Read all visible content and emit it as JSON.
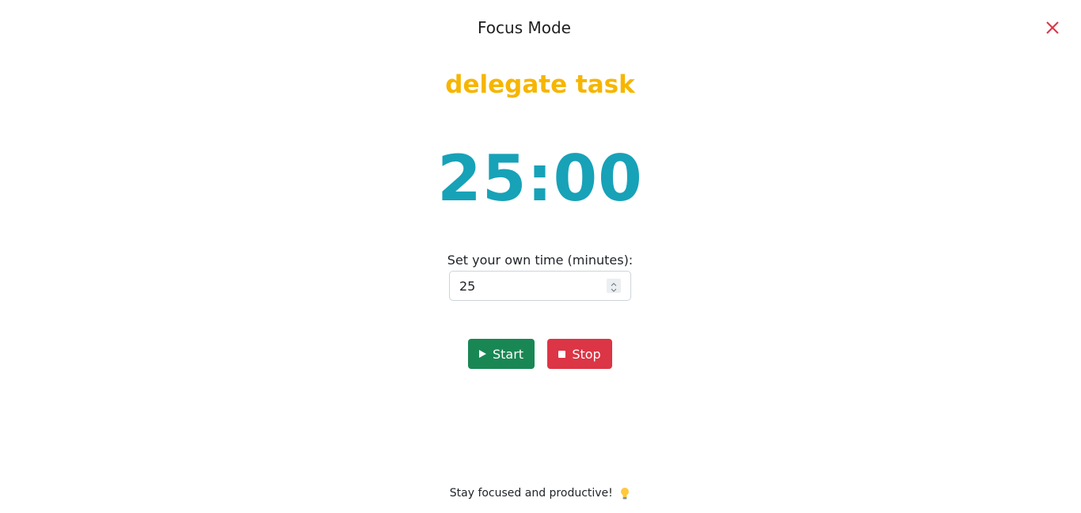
{
  "header": {
    "title": "Focus Mode"
  },
  "task": {
    "name": "delegate task"
  },
  "timer": {
    "display": "25:00"
  },
  "custom_time": {
    "label": "Set your own time (minutes):",
    "value": "25"
  },
  "controls": {
    "start_label": "Start",
    "stop_label": "Stop"
  },
  "footer": {
    "message": "Stay focused and productive!"
  },
  "icons": {
    "close": "close-icon",
    "start": "play-icon",
    "stop": "stop-icon",
    "footer": "lightbulb-icon"
  },
  "colors": {
    "task": "#f6b500",
    "timer": "#17a2b8",
    "start": "#198754",
    "stop": "#dc3545",
    "close": "#dc3545"
  }
}
